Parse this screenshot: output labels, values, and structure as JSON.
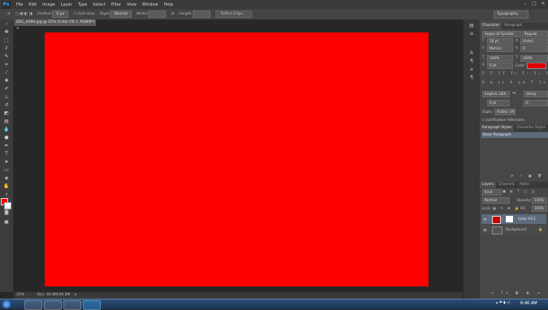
{
  "app": {
    "logo": "Ps"
  },
  "menu": [
    "File",
    "Edit",
    "Image",
    "Layer",
    "Type",
    "Select",
    "Filter",
    "View",
    "Window",
    "Help"
  ],
  "options": {
    "feather_label": "Feather:",
    "feather_value": "0 px",
    "antialias_label": "Anti-alias",
    "style_label": "Style:",
    "style_value": "Normal",
    "width_label": "Width:",
    "height_label": "Height:",
    "refine_label": "Refine Edge...",
    "workspace": "Typography"
  },
  "document": {
    "tab_title": "DSC_4394.jpg @ 25% (Color Fill 1, RGB/8*) ×",
    "fill_color": "#ff0000",
    "zoom": "25%",
    "doc_info": "Doc: 46.8M/46.8M"
  },
  "character_panel": {
    "tabs": [
      "Character",
      "Paragraph"
    ],
    "font_family": "Segoe UI Symbol",
    "font_style": "Regular",
    "font_size": "18 pt",
    "leading": "(Auto)",
    "kerning": "Metrics",
    "tracking": "0",
    "vscale": "100%",
    "hscale": "100%",
    "baseline": "0 pt",
    "color_label": "Color:",
    "color_value": "#e00000",
    "language": "English: USA",
    "aa": "Sharp",
    "arabic_label": "Digits:",
    "arabic_value": "Arabic: US",
    "justify_label": "Justification Alternates"
  },
  "paragraph_styles": {
    "tabs": [
      "Paragraph Styles",
      "Character Styles"
    ],
    "items": [
      "Basic Paragraph"
    ]
  },
  "layers_panel": {
    "tabs": [
      "Layers",
      "Channels",
      "Paths"
    ],
    "kind_label": "Kind",
    "blend_mode": "Normal",
    "opacity_label": "Opacity:",
    "opacity_value": "100%",
    "lock_label": "Lock:",
    "fill_label": "Fill:",
    "fill_value": "100%",
    "layers": [
      {
        "name": "Color Fill 1",
        "selected": true
      },
      {
        "name": "Background",
        "selected": false
      }
    ]
  },
  "taskbar": {
    "time": "8:46 AM"
  }
}
